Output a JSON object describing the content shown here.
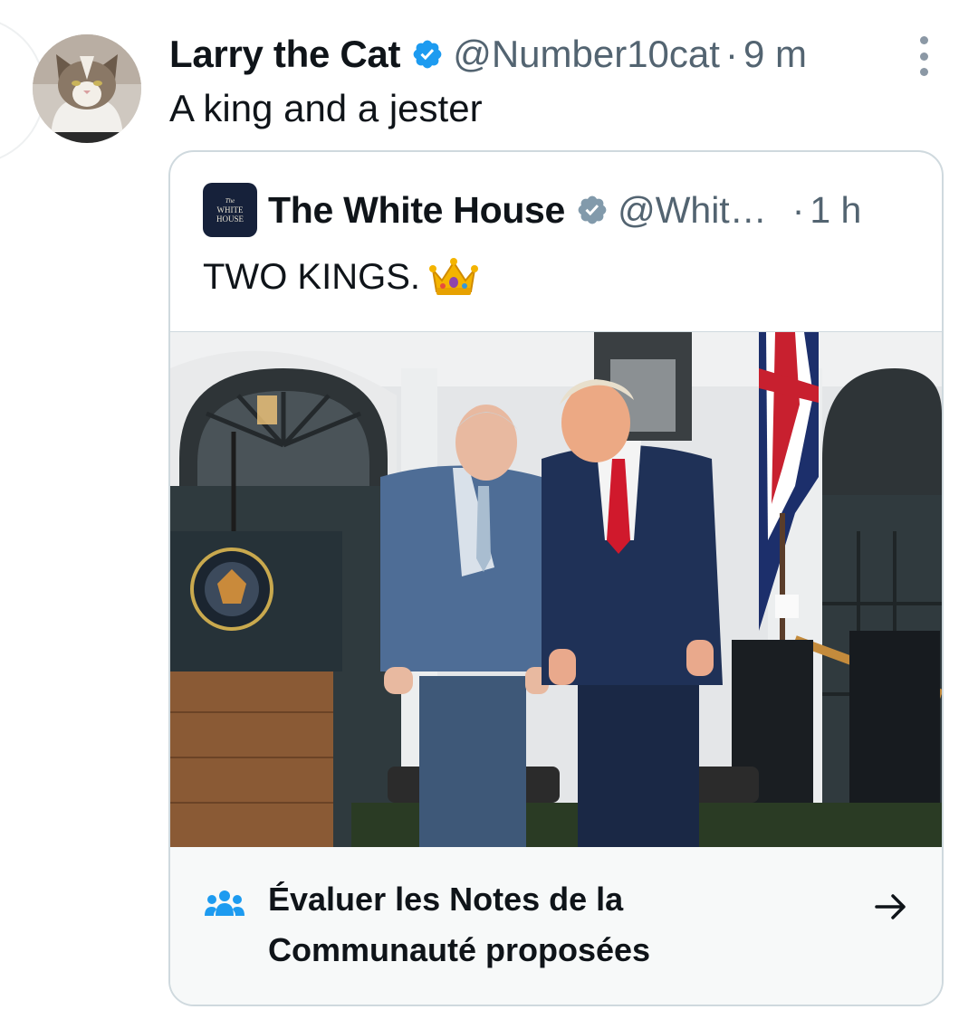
{
  "tweet": {
    "author_name": "Larry the Cat",
    "handle": "@Number10cat",
    "separator": "·",
    "time": "9 m",
    "text": "A king and a jester",
    "more_icon": "more-vertical-icon",
    "verified_icon": "verified-badge-icon"
  },
  "quoted": {
    "avatar_lines": [
      "The",
      "WHITE",
      "HOUSE"
    ],
    "author_name": "The White House",
    "handle": "@Whit…",
    "separator": "·",
    "time": "1 h",
    "text": "TWO KINGS.",
    "emoji_icon": "crown-emoji-icon",
    "verified_icon": "gray-verified-badge-icon",
    "photo_icon": "photo-two-men-at-podium"
  },
  "community_notes": {
    "label_line1": "Évaluer les Notes de la",
    "label_line2": "Communauté proposées",
    "icon": "people-icon",
    "arrow": "arrow-right-icon"
  },
  "colors": {
    "verified_blue": "#1d9bf0",
    "gray_text": "#536471",
    "border": "#cfd9de",
    "notes_bg": "#f7f9f9"
  }
}
